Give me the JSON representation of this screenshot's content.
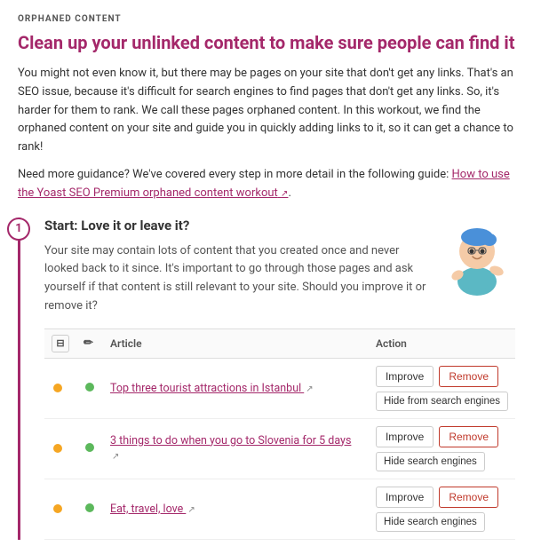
{
  "page": {
    "section_label": "ORPHANED CONTENT",
    "main_title": "Clean up your unlinked content to make sure people can find it",
    "intro_text": "You might not even know it, but there may be pages on your site that don't get any links. That's an SEO issue, because it's difficult for search engines to find pages that don't get any links. So, it's harder for them to rank. We call these pages orphaned content. In this workout, we find the orphaned content on your site and guide you in quickly adding links to it, so it can get a chance to rank!",
    "guidance_prefix": "Need more guidance? We've covered every step in more detail in the following guide: ",
    "guidance_link_text": "How to use the Yoast SEO Premium orphaned content workout",
    "guidance_link_icon": "↗",
    "step_number": "1",
    "step_title": "Start: Love it or leave it?",
    "step_description": "Your site may contain lots of content that you created once and never looked back to it since. It's important to go through those pages and ask yourself if that content is still relevant to your site. Should you improve it or remove it?",
    "table": {
      "col_icons": "",
      "col_edit": "",
      "col_article": "Article",
      "col_action": "Action",
      "rows": [
        {
          "dot1": "orange",
          "dot2": "green",
          "article_text": "Top three tourist attractions in Istanbul",
          "article_link": "#",
          "btn_improve": "Improve",
          "btn_remove": "Remove",
          "btn_hide": "Hide from search engines"
        },
        {
          "dot1": "orange",
          "dot2": "green",
          "article_text": "3 things to do when you go to Slovenia for 5 days",
          "article_link": "#",
          "btn_improve": "Improve",
          "btn_remove": "Remove",
          "btn_hide": "Hide search engines"
        },
        {
          "dot1": "orange",
          "dot2": "green",
          "article_text": "Eat, travel, love",
          "article_link": "#",
          "btn_improve": "Improve",
          "btn_remove": "Remove",
          "btn_hide": "Hide search engines"
        }
      ]
    }
  }
}
